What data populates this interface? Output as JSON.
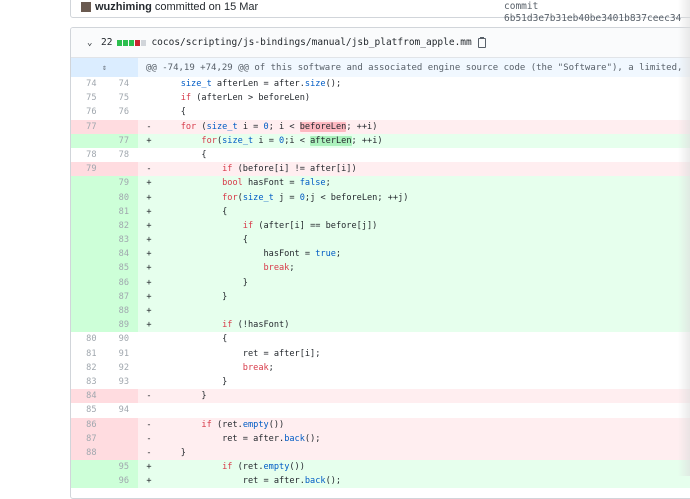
{
  "commit": {
    "author": "wuzhiming",
    "text": " committed on 15 Mar",
    "sha": "commit 6b51d3e7b31eb40be3401b837ceec34"
  },
  "file": {
    "chevron_icon": "chevron-down-icon",
    "changes": "22",
    "diffstat": [
      "#2cbe4e",
      "#2cbe4e",
      "#2cbe4e",
      "#cb2431",
      "#d1d5da"
    ],
    "path": "cocos/scripting/js-bindings/manual/jsb_platfrom_apple.mm",
    "copy_icon": "clipboard-icon"
  },
  "hunk": {
    "expand_icon": "unfold-icon",
    "expand_glyph": "⇕",
    "header": "@@ -74,19 +74,29 @@ of this software and associated engine source code (the \"Software\"), a limited,"
  },
  "colors": {
    "del_bg": "#ffeef0",
    "add_bg": "#e6ffed",
    "hunk_bg": "#f1f8ff"
  },
  "lines": [
    {
      "type": "ctx",
      "old": "74",
      "new": "74",
      "mark": "",
      "code": "    size_t afterLen = after.size();"
    },
    {
      "type": "ctx",
      "old": "75",
      "new": "75",
      "mark": "",
      "code": "    if (afterLen > beforeLen)"
    },
    {
      "type": "ctx",
      "old": "76",
      "new": "76",
      "mark": "",
      "code": "    {"
    },
    {
      "type": "del",
      "old": "77",
      "new": "",
      "mark": "-",
      "code": "    for (size_t i = 0; i < beforeLen; ++i)",
      "highlight": "beforeLen"
    },
    {
      "type": "add",
      "old": "",
      "new": "77",
      "mark": "+",
      "code": "        for(size_t i = 0;i < afterLen; ++i)",
      "highlight": "afterLen"
    },
    {
      "type": "ctx",
      "old": "78",
      "new": "78",
      "mark": "",
      "code": "        {"
    },
    {
      "type": "del",
      "old": "79",
      "new": "",
      "mark": "-",
      "code": "            if (before[i] != after[i])"
    },
    {
      "type": "add",
      "old": "",
      "new": "79",
      "mark": "+",
      "code": "            bool hasFont = false;"
    },
    {
      "type": "add",
      "old": "",
      "new": "80",
      "mark": "+",
      "code": "            for(size_t j = 0;j < beforeLen; ++j)"
    },
    {
      "type": "add",
      "old": "",
      "new": "81",
      "mark": "+",
      "code": "            {"
    },
    {
      "type": "add",
      "old": "",
      "new": "82",
      "mark": "+",
      "code": "                if (after[i] == before[j])"
    },
    {
      "type": "add",
      "old": "",
      "new": "83",
      "mark": "+",
      "code": "                {"
    },
    {
      "type": "add",
      "old": "",
      "new": "84",
      "mark": "+",
      "code": "                    hasFont = true;"
    },
    {
      "type": "add",
      "old": "",
      "new": "85",
      "mark": "+",
      "code": "                    break;"
    },
    {
      "type": "add",
      "old": "",
      "new": "86",
      "mark": "+",
      "code": "                }"
    },
    {
      "type": "add",
      "old": "",
      "new": "87",
      "mark": "+",
      "code": "            }"
    },
    {
      "type": "add",
      "old": "",
      "new": "88",
      "mark": "+",
      "code": ""
    },
    {
      "type": "add",
      "old": "",
      "new": "89",
      "mark": "+",
      "code": "            if (!hasFont)"
    },
    {
      "type": "ctx",
      "old": "80",
      "new": "90",
      "mark": "",
      "code": "            {"
    },
    {
      "type": "ctx",
      "old": "81",
      "new": "91",
      "mark": "",
      "code": "                ret = after[i];"
    },
    {
      "type": "ctx",
      "old": "82",
      "new": "92",
      "mark": "",
      "code": "                break;"
    },
    {
      "type": "ctx",
      "old": "83",
      "new": "93",
      "mark": "",
      "code": "            }"
    },
    {
      "type": "del",
      "old": "84",
      "new": "",
      "mark": "-",
      "code": "        }"
    },
    {
      "type": "ctx",
      "old": "85",
      "new": "94",
      "mark": "",
      "code": ""
    },
    {
      "type": "del",
      "old": "86",
      "new": "",
      "mark": "-",
      "code": "        if (ret.empty())"
    },
    {
      "type": "del",
      "old": "87",
      "new": "",
      "mark": "-",
      "code": "            ret = after.back();"
    },
    {
      "type": "del",
      "old": "88",
      "new": "",
      "mark": "-",
      "code": "    }"
    },
    {
      "type": "add",
      "old": "",
      "new": "95",
      "mark": "+",
      "code": "            if (ret.empty())"
    },
    {
      "type": "add",
      "old": "",
      "new": "96",
      "mark": "+",
      "code": "                ret = after.back();"
    }
  ]
}
